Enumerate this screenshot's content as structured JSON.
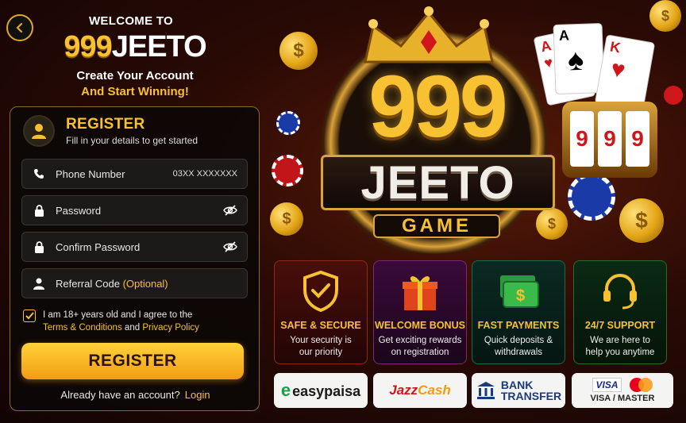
{
  "header": {
    "welcome": "WELCOME TO",
    "brand_num": "999",
    "brand_word": "JEETO",
    "tagline_1": "Create Your Account",
    "tagline_2": "And Start Winning!"
  },
  "register": {
    "title": "REGISTER",
    "subtitle": "Fill in your details to get started",
    "fields": {
      "phone": {
        "label": "Phone Number",
        "hint": "03XX XXXXXXX",
        "icon": "phone-icon"
      },
      "password": {
        "label": "Password",
        "icon": "lock-icon"
      },
      "confirm": {
        "label": "Confirm Password",
        "icon": "lock-icon"
      },
      "referral": {
        "label": "Referral Code",
        "optional": "(Optional)",
        "icon": "user-icon"
      }
    },
    "agree_prefix": "I am 18+ years old and I agree to the",
    "terms": "Terms & Conditions",
    "and": "and",
    "privacy": "Privacy Policy",
    "checked": true,
    "button": "REGISTER",
    "have_account": "Already have an account?",
    "login": "Login"
  },
  "hero": {
    "num": "999",
    "word": "JEETO",
    "sub": "GAME"
  },
  "features": [
    {
      "title": "SAFE & SECURE",
      "desc1": "Your security is",
      "desc2": "our priority",
      "icon": "shield-check-icon"
    },
    {
      "title": "WELCOME BONUS",
      "desc1": "Get exciting rewards",
      "desc2": "on registration",
      "icon": "gift-icon"
    },
    {
      "title": "FAST PAYMENTS",
      "desc1": "Quick deposits &",
      "desc2": "withdrawals",
      "icon": "cash-icon"
    },
    {
      "title": "24/7 SUPPORT",
      "desc1": "We are here to",
      "desc2": "help you anytime",
      "icon": "headset-icon"
    }
  ],
  "payments": {
    "easypaisa": "easypaisa",
    "jazz": "Jazz",
    "cash": "Cash",
    "bank_1": "BANK",
    "bank_2": "TRANSFER",
    "visa": "VISA",
    "visa_master": "VISA / MASTER"
  },
  "colors": {
    "accent": "#f7c131",
    "button_top": "#ffd23a",
    "button_bottom": "#f39c12"
  }
}
